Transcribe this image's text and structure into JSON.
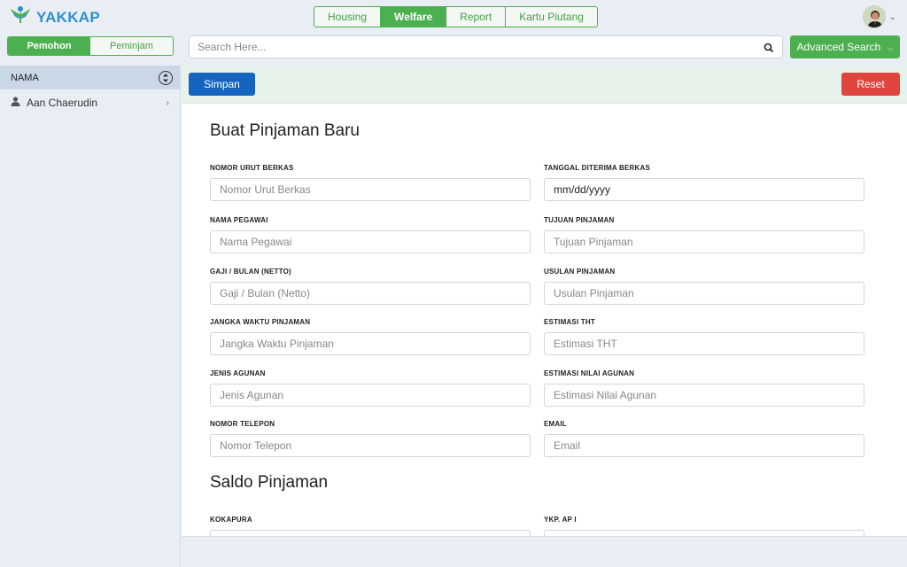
{
  "app": {
    "logo_text": "YAKKAP",
    "brand_color": "#2e8fd0",
    "accent_color": "#4caf50"
  },
  "nav": {
    "tabs": [
      {
        "label": "Housing",
        "active": false
      },
      {
        "label": "Welfare",
        "active": true
      },
      {
        "label": "Report",
        "active": false
      },
      {
        "label": "Kartu Piutang",
        "active": false
      }
    ]
  },
  "mode": {
    "items": [
      {
        "label": "Pemohon",
        "active": true
      },
      {
        "label": "Peminjam",
        "active": false
      }
    ]
  },
  "search": {
    "placeholder": "Search Here...",
    "advanced_label": "Advanced Search"
  },
  "sidebar": {
    "header": "NAMA",
    "items": [
      {
        "label": "Aan Chaerudin",
        "icon": "user-icon"
      }
    ]
  },
  "toolbar": {
    "save_label": "Simpan",
    "reset_label": "Reset"
  },
  "form": {
    "title": "Buat Pinjaman Baru",
    "fields": [
      {
        "label": "NOMOR URUT BERKAS",
        "placeholder": "Nomor Urut Berkas"
      },
      {
        "label": "TANGGAL DITERIMA BERKAS",
        "placeholder": "mm/dd/yyyy"
      },
      {
        "label": "NAMA PEGAWAI",
        "placeholder": "Nama Pegawai"
      },
      {
        "label": "TUJUAN PINJAMAN",
        "placeholder": "Tujuan Pinjaman"
      },
      {
        "label": "GAJI / BULAN (NETTO)",
        "placeholder": "Gaji / Bulan (Netto)"
      },
      {
        "label": "USULAN PINJAMAN",
        "placeholder": "Usulan Pinjaman"
      },
      {
        "label": "JANGKA WAKTU PINJAMAN",
        "placeholder": "Jangka Waktu Pinjaman"
      },
      {
        "label": "ESTIMASI THT",
        "placeholder": "Estimasi THT"
      },
      {
        "label": "JENIS AGUNAN",
        "placeholder": "Jenis Agunan"
      },
      {
        "label": "ESTIMASI NILAI AGUNAN",
        "placeholder": "Estimasi Nilai Agunan"
      },
      {
        "label": "NOMOR TELEPON",
        "placeholder": "Nomor Telepon"
      },
      {
        "label": "EMAIL",
        "placeholder": "Email"
      }
    ],
    "saldo_title": "Saldo Pinjaman",
    "saldo_fields": [
      {
        "label": "KOKAPURA",
        "placeholder": ""
      },
      {
        "label": "YKP. AP I",
        "placeholder": ""
      }
    ]
  }
}
